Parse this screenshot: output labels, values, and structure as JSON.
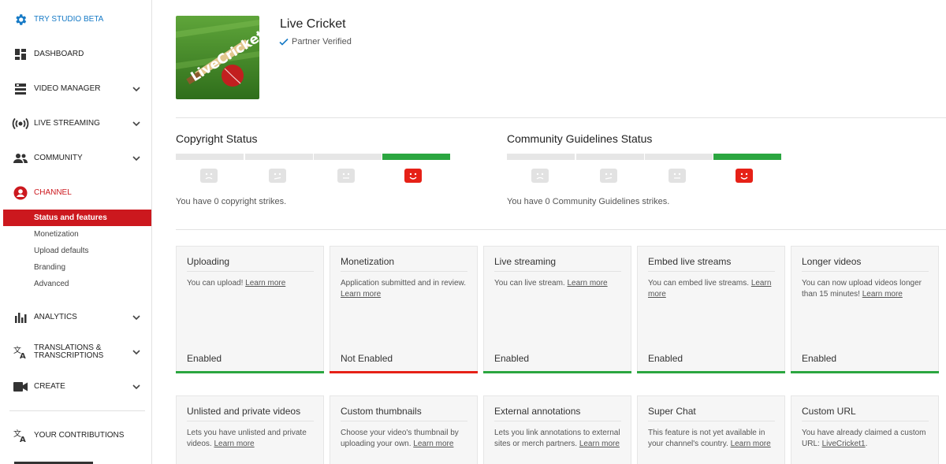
{
  "colors": {
    "accent_red": "#cc181e",
    "beta_blue": "#167ac6",
    "enabled_green": "#2ba640",
    "disabled_red": "#e62117"
  },
  "sidebar": {
    "studio_beta": {
      "label": "TRY STUDIO BETA",
      "icon": "gear-icon"
    },
    "items": [
      {
        "label": "DASHBOARD",
        "icon": "dashboard-icon"
      },
      {
        "label": "VIDEO MANAGER",
        "icon": "video-manager-icon"
      },
      {
        "label": "LIVE STREAMING",
        "icon": "live-streaming-icon"
      },
      {
        "label": "COMMUNITY",
        "icon": "community-icon"
      },
      {
        "label": "CHANNEL",
        "icon": "channel-icon"
      },
      {
        "label": "ANALYTICS",
        "icon": "analytics-icon"
      },
      {
        "label": "TRANSLATIONS &",
        "label2": "TRANSCRIPTIONS",
        "icon": "translate-icon"
      },
      {
        "label": "CREATE",
        "icon": "create-icon"
      },
      {
        "label": "YOUR CONTRIBUTIONS",
        "icon": "contributions-icon"
      }
    ],
    "channel_subitems": [
      "Status and features",
      "Monetization",
      "Upload defaults",
      "Branding",
      "Advanced"
    ],
    "active_subitem": "Status and features"
  },
  "channel": {
    "name": "Live Cricket",
    "partner_status": "Partner Verified",
    "thumbnail_text": "LiveCricket"
  },
  "copyright": {
    "title": "Copyright Status",
    "strikes_text": "You have 0 copyright strikes."
  },
  "community": {
    "title": "Community Guidelines Status",
    "strikes_text": "You have 0 Community Guidelines strikes."
  },
  "features_row1": [
    {
      "title": "Uploading",
      "desc": "You can upload! ",
      "link": "Learn more",
      "status": "Enabled",
      "enabled": true
    },
    {
      "title": "Monetization",
      "desc": "Application submitted and in review. ",
      "link": "Learn more",
      "status": "Not Enabled",
      "enabled": false
    },
    {
      "title": "Live streaming",
      "desc": "You can live stream. ",
      "link": "Learn more",
      "status": "Enabled",
      "enabled": true
    },
    {
      "title": "Embed live streams",
      "desc": "You can embed live streams. ",
      "link": "Learn more",
      "status": "Enabled",
      "enabled": true
    },
    {
      "title": "Longer videos",
      "desc": "You can now upload videos longer than 15 minutes! ",
      "link": "Learn more",
      "status": "Enabled",
      "enabled": true
    }
  ],
  "features_row2": [
    {
      "title": "Unlisted and private videos",
      "desc": "Lets you have unlisted and private videos. ",
      "link": "Learn more",
      "suffix": ""
    },
    {
      "title": "Custom thumbnails",
      "desc": "Choose your video's thumbnail by uploading your own. ",
      "link": "Learn more",
      "suffix": ""
    },
    {
      "title": "External annotations",
      "desc": "Lets you link annotations to external sites or merch partners. ",
      "link": "Learn more",
      "suffix": ""
    },
    {
      "title": "Super Chat",
      "desc": "This feature is not yet available in your channel's country. ",
      "link": "Learn more",
      "suffix": ""
    },
    {
      "title": "Custom URL",
      "desc": "You have already claimed a custom URL: ",
      "link": "LiveCricket1",
      "suffix": "."
    }
  ]
}
